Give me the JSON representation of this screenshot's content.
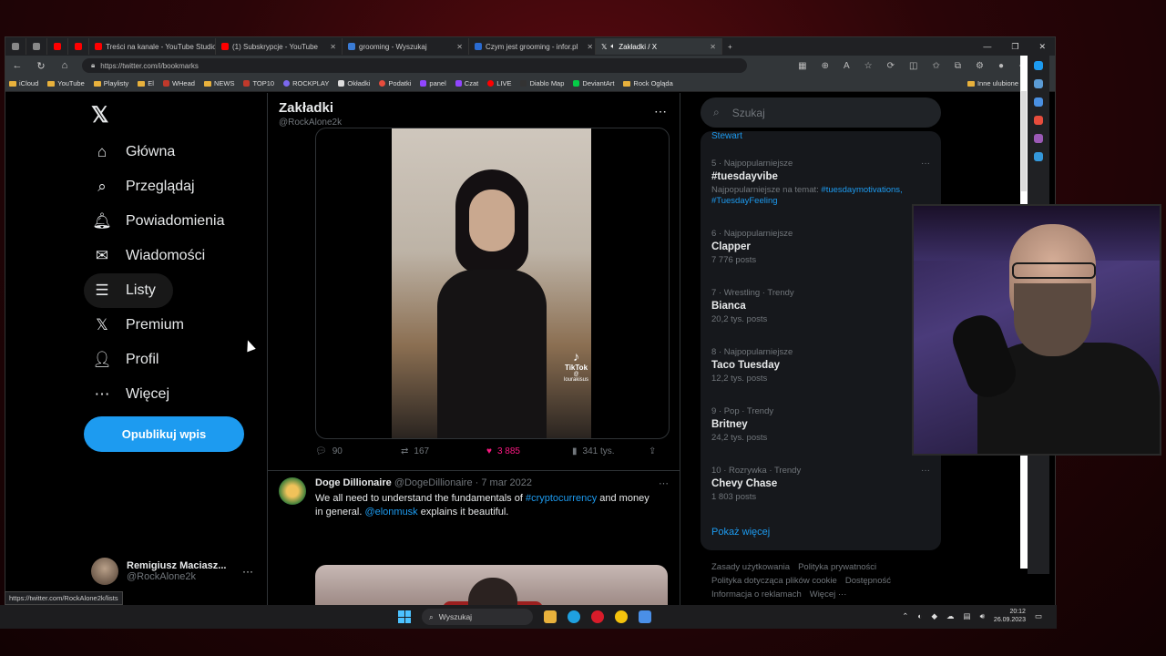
{
  "browser": {
    "tabs": [
      {
        "label": "Treści na kanale - YouTube Studio",
        "color": "#ff0000"
      },
      {
        "label": "(1) Subskrypcje - YouTube",
        "color": "#ff0000"
      },
      {
        "label": "grooming - Wyszukaj",
        "color": "#3a7bd5"
      },
      {
        "label": "Czym jest grooming - infor.pl",
        "color": "#2a6bd1"
      },
      {
        "label": "Zakładki / X",
        "color": "#ffffff",
        "active": true
      }
    ],
    "url": "https://twitter.com/i/bookmarks",
    "bookmarks": [
      "iCloud",
      "YouTube",
      "Playlisty",
      "El",
      "WHead",
      "NEWS",
      "TOP10",
      "ROCKPLAY",
      "Okładki",
      "Podatki",
      "panel",
      "Czat",
      "LIVE",
      "Diablo Map",
      "DeviantArt",
      "Rock Ogląda"
    ],
    "bookmarks_right": "Inne ulubione",
    "status_url": "https://twitter.com/RockAlone2k/lists"
  },
  "sidebar": {
    "nav": [
      {
        "label": "Główna",
        "icon": "home-icon",
        "glyph": "⌂"
      },
      {
        "label": "Przeglądaj",
        "icon": "search-icon",
        "glyph": "⌕"
      },
      {
        "label": "Powiadomienia",
        "icon": "bell-icon",
        "glyph": "🔔︎"
      },
      {
        "label": "Wiadomości",
        "icon": "mail-icon",
        "glyph": "✉"
      },
      {
        "label": "Listy",
        "icon": "list-icon",
        "glyph": "☰"
      },
      {
        "label": "Premium",
        "icon": "x-premium-icon",
        "glyph": "𝕏"
      },
      {
        "label": "Profil",
        "icon": "profile-icon",
        "glyph": "👤︎"
      },
      {
        "label": "Więcej",
        "icon": "more-icon",
        "glyph": "⋯"
      }
    ],
    "post_button": "Opublikuj wpis",
    "account": {
      "name": "Remigiusz Maciasz...",
      "handle": "@RockAlone2k"
    }
  },
  "main": {
    "title": "Zakładki",
    "handle": "@RockAlone2k",
    "tweet1": {
      "watermark": "TikTok",
      "watermark_user": "@ lourakisus",
      "replies": "90",
      "reposts": "167",
      "likes": "3 885",
      "views": "341 tys."
    },
    "tweet2": {
      "name": "Doge Dillionaire",
      "handle": "@DogeDillionaire",
      "date": "7 mar 2022",
      "text_a": "We all need to understand the fundamentals of ",
      "link_a": "#cryptocurrency",
      "text_b": " and money in general. ",
      "link_b": "@elonmusk",
      "text_c": " explains it beautiful."
    }
  },
  "right": {
    "search_placeholder": "Szukaj",
    "stewart": "Stewart",
    "trends": [
      {
        "meta": "5 · Najpopularniejsze",
        "name": "#tuesdayvibe",
        "sub": "Najpopularniejsze na temat: ",
        "sub_links": "#tuesdaymotivations, #TuesdayFeeling"
      },
      {
        "meta": "6 · Najpopularniejsze",
        "name": "Clapper",
        "sub": "7 776 posts"
      },
      {
        "meta": "7 · Wrestling · Trendy",
        "name": "Bianca",
        "sub": "20,2 tys. posts"
      },
      {
        "meta": "8 · Najpopularniejsze",
        "name": "Taco Tuesday",
        "sub": "12,2 tys. posts"
      },
      {
        "meta": "9 · Pop · Trendy",
        "name": "Britney",
        "sub": "24,2 tys. posts"
      },
      {
        "meta": "10 · Rozrywka · Trendy",
        "name": "Chevy Chase",
        "sub": "1 803 posts"
      }
    ],
    "show_more": "Pokaż więcej",
    "footer": [
      "Zasady użytkowania",
      "Polityka prywatności",
      "Polityka dotycząca plików cookie",
      "Dostępność",
      "Informacja o reklamach",
      "Więcej ···"
    ]
  },
  "taskbar": {
    "search_label": "Wyszukaj",
    "time": "20:12",
    "date": "26.09.2023"
  },
  "colors": {
    "accent": "#1d9bf0",
    "like": "#f91880",
    "background": "#000000"
  }
}
